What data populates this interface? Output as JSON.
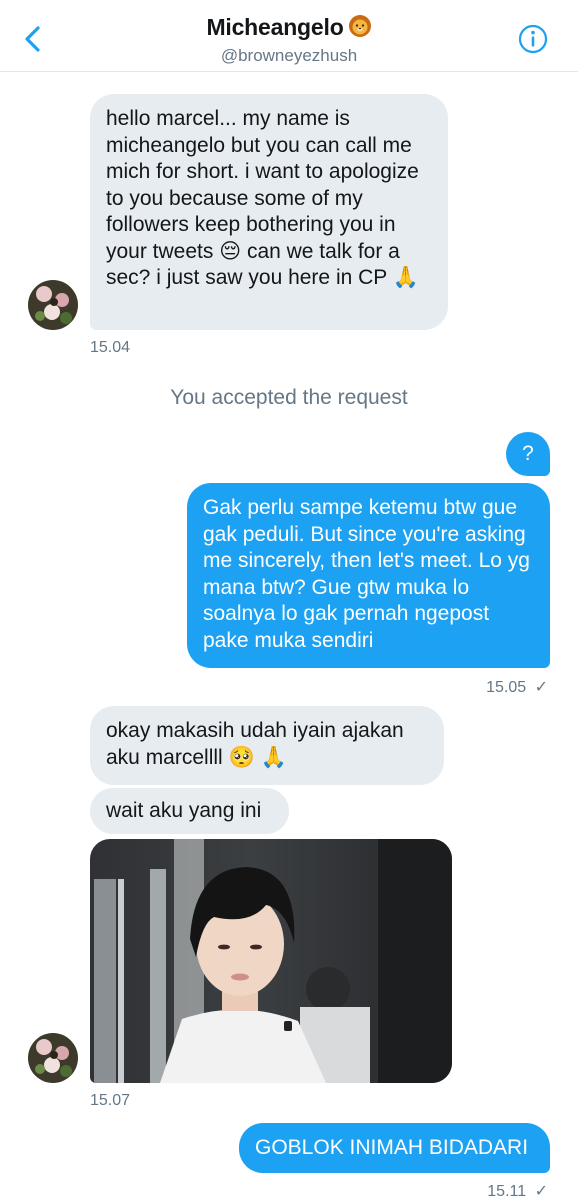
{
  "header": {
    "title": "Micheangelo",
    "handle": "@browneyezhush",
    "back_icon": "chevron-left-icon",
    "info_icon": "info-icon",
    "accent": "#1da1f2"
  },
  "messages": {
    "m1": "hello marcel... my name is micheangelo but you can call me mich for short. i want to apologize to you because some of my followers keep bothering you in your tweets 😔 can we talk for a sec? i just saw you here in CP 🙏",
    "m1_time": "15.04",
    "system": "You accepted the request",
    "m2": "?",
    "m3": "Gak perlu sampe ketemu btw gue gak peduli. But since you're asking me sincerely, then let's meet. Lo yg mana btw? Gue gtw muka lo soalnya lo gak pernah ngepost pake muka sendiri",
    "m3_time": "15.05",
    "m3_status": "✓",
    "m4": "okay makasih udah iyain ajakan aku marcellll 🥺 🙏",
    "m5": "wait aku yang ini",
    "m5_time": "15.07",
    "m6": "GOBLOK INIMAH BIDADARI",
    "m6_time": "15.11",
    "m6_status": "✓"
  },
  "colors": {
    "incoming_bubble": "#e6ecf0",
    "outgoing_bubble": "#1da1f2",
    "meta_text": "#657786"
  }
}
